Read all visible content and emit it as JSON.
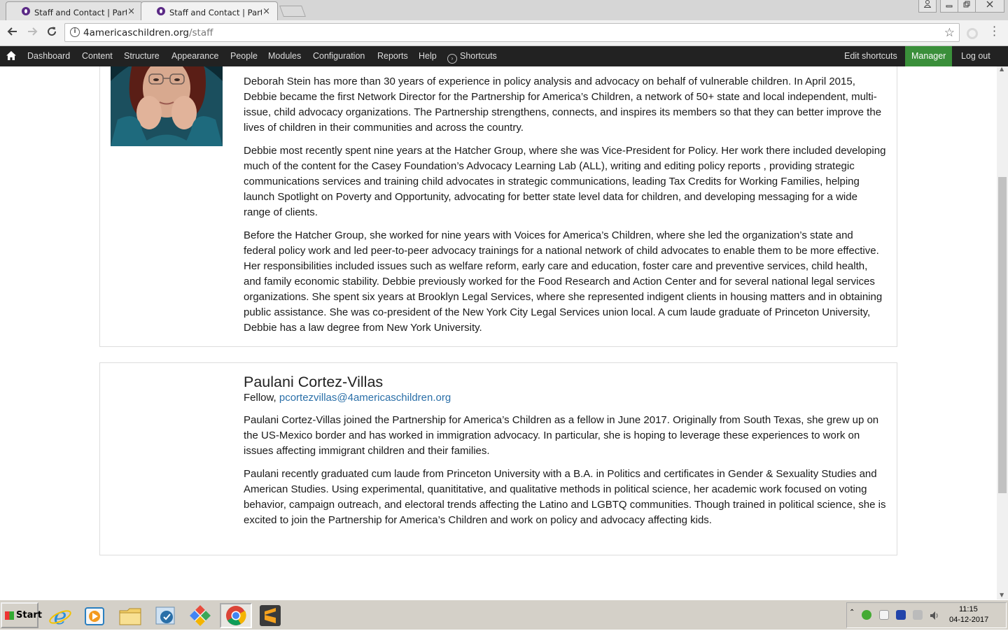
{
  "browser": {
    "tabs": [
      {
        "title": "Staff and Contact | Partner",
        "active": false
      },
      {
        "title": "Staff and Contact | Partner",
        "active": true
      }
    ],
    "url_host": "4americaschildren.org",
    "url_path": "/staff",
    "tab_close_glyph": "×"
  },
  "admin_toolbar": {
    "items": [
      "Dashboard",
      "Content",
      "Structure",
      "Appearance",
      "People",
      "Modules",
      "Configuration",
      "Reports",
      "Help"
    ],
    "shortcuts": "Shortcuts",
    "edit_shortcuts": "Edit shortcuts",
    "manager": "Manager",
    "logout": "Log out",
    "manager_color": "#3a8f3a"
  },
  "staff": [
    {
      "paragraphs": [
        "Deborah Stein has more than 30 years of experience in policy analysis and advocacy on behalf of vulnerable children. In April 2015, Debbie became the first Network Director for the Partnership for America’s Children, a network of 50+ state and local independent, multi-issue, child advocacy organizations. The Partnership strengthens, connects, and inspires its members so that they can better improve the lives of children in their communities and across the country.",
        "Debbie most recently spent nine years at the Hatcher Group, where she was Vice-President for Policy. Her work there included developing much of the content for the Casey Foundation’s Advocacy Learning Lab (ALL), writing and editing policy reports , providing strategic communications services and training child advocates in strategic communications, leading Tax Credits for Working Families, helping launch Spotlight on Poverty and Opportunity, advocating for better state level data for children, and developing messaging for a wide range of clients.",
        "Before the Hatcher Group, she worked for nine years with Voices for America’s Children, where she led the organization’s state and federal policy work and led peer-to-peer advocacy trainings for a national network of child advocates to enable them to be more effective. Her responsibilities included issues such as welfare reform, early care and education, foster care and preventive services, child health, and family economic stability. Debbie previously worked for the Food Research and Action Center and for several national legal services organizations. She spent six years at Brooklyn Legal Services, where she represented indigent clients in housing matters and in obtaining public assistance. She was co-president of the New York City Legal Services union local. A cum laude graduate of Princeton University, Debbie has a law degree from New York University."
      ]
    },
    {
      "name": "Paulani Cortez-Villas",
      "role": "Fellow,",
      "email": "pcortezvillas@4americaschildren.org",
      "paragraphs": [
        "Paulani Cortez-Villas joined the Partnership for America’s Children as a fellow in June 2017. Originally from South Texas, she grew up on the US-Mexico border and has worked in immigration advocacy. In particular, she is hoping to leverage these experiences to work on issues affecting immigrant children and their families.",
        "Paulani recently graduated cum laude from Princeton University with a B.A. in Politics and certificates in Gender & Sexuality Studies and American Studies. Using experimental, quanititative, and qualitative methods in political science, her academic work focused on voting behavior, campaign outreach, and electoral trends affecting the Latino and LGBTQ communities. Though trained in political science, she is excited to join the Partnership for America’s Children and work on policy and advocacy affecting kids."
      ]
    }
  ],
  "taskbar": {
    "start": "Start",
    "time": "11:15",
    "date": "04-12-2017"
  }
}
